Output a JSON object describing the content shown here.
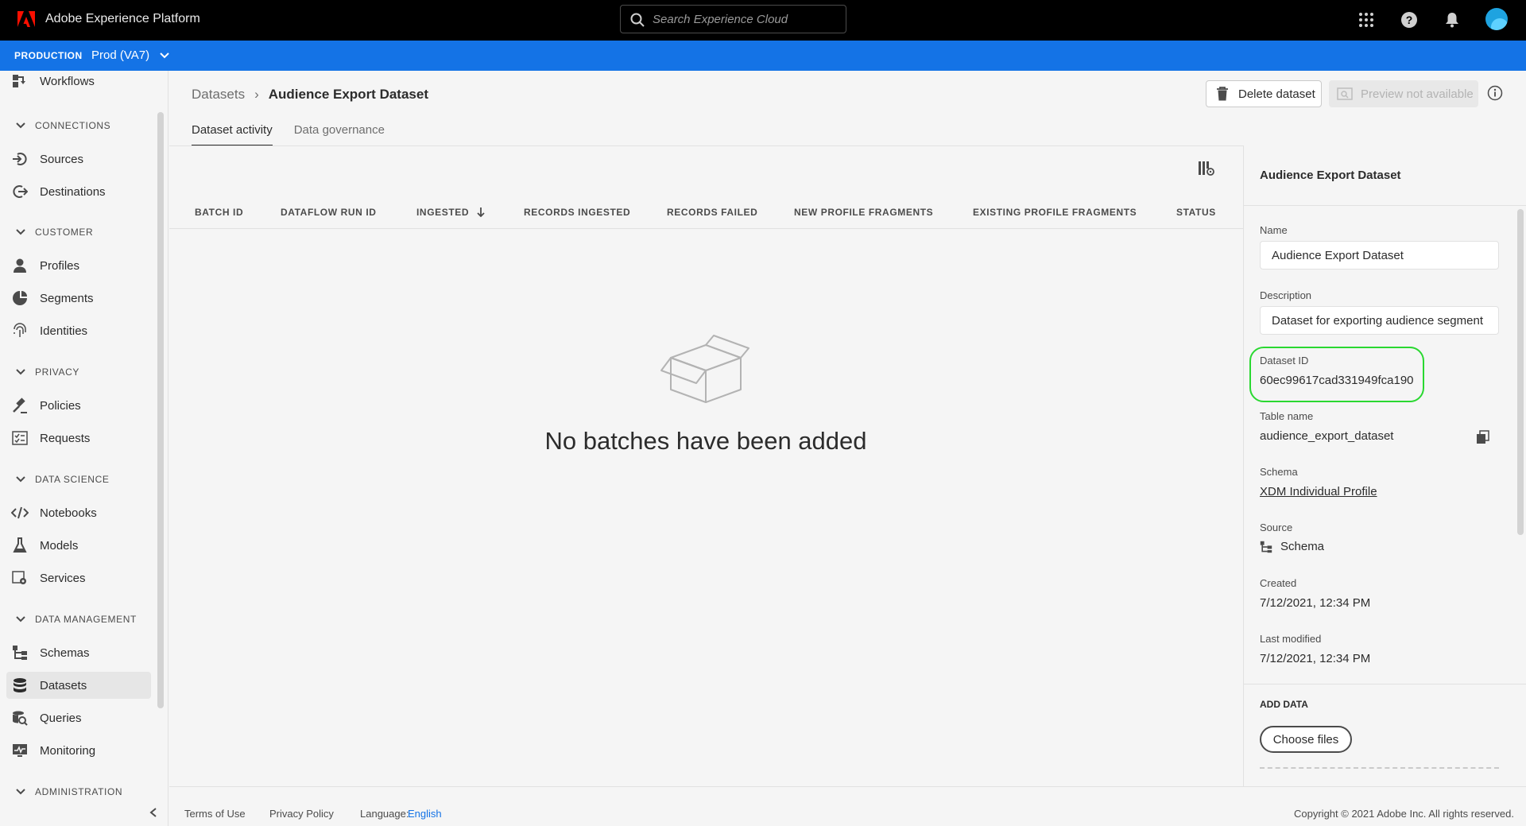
{
  "shell": {
    "app_title": "Adobe Experience Platform",
    "search_placeholder": "Search Experience Cloud"
  },
  "sandbox": {
    "environment": "PRODUCTION",
    "name": "Prod (VA7)"
  },
  "leftnav": {
    "items": [
      {
        "label": "Workflows",
        "icon": "workflows-icon"
      },
      {
        "section": "CONNECTIONS"
      },
      {
        "label": "Sources",
        "icon": "sources-icon"
      },
      {
        "label": "Destinations",
        "icon": "destinations-icon"
      },
      {
        "section": "CUSTOMER"
      },
      {
        "label": "Profiles",
        "icon": "profile-icon"
      },
      {
        "label": "Segments",
        "icon": "segments-icon"
      },
      {
        "label": "Identities",
        "icon": "fingerprint-icon"
      },
      {
        "section": "PRIVACY"
      },
      {
        "label": "Policies",
        "icon": "gavel-icon"
      },
      {
        "label": "Requests",
        "icon": "checklist-icon"
      },
      {
        "section": "DATA SCIENCE"
      },
      {
        "label": "Notebooks",
        "icon": "code-icon"
      },
      {
        "label": "Models",
        "icon": "beaker-icon"
      },
      {
        "label": "Services",
        "icon": "services-icon"
      },
      {
        "section": "DATA MANAGEMENT"
      },
      {
        "label": "Schemas",
        "icon": "schema-icon"
      },
      {
        "label": "Datasets",
        "icon": "database-icon",
        "active": true
      },
      {
        "label": "Queries",
        "icon": "query-icon"
      },
      {
        "label": "Monitoring",
        "icon": "monitoring-icon"
      },
      {
        "section": "ADMINISTRATION"
      }
    ]
  },
  "header": {
    "breadcrumb_parent": "Datasets",
    "breadcrumb_current": "Audience Export Dataset",
    "delete_label": "Delete dataset",
    "preview_label": "Preview not available",
    "tabs": [
      {
        "label": "Dataset activity",
        "active": true
      },
      {
        "label": "Data governance",
        "active": false
      }
    ]
  },
  "table": {
    "columns": [
      "BATCH ID",
      "DATAFLOW RUN ID",
      "INGESTED",
      "RECORDS INGESTED",
      "RECORDS FAILED",
      "NEW PROFILE FRAGMENTS",
      "EXISTING PROFILE FRAGMENTS",
      "STATUS"
    ],
    "sorted_column": "INGESTED",
    "sort_direction": "descending",
    "rows": [],
    "empty_message": "No batches have been added"
  },
  "details": {
    "title": "Audience Export Dataset",
    "name_label": "Name",
    "name_value": "Audience Export Dataset",
    "description_label": "Description",
    "description_value": "Dataset for exporting audience segment",
    "dataset_id_label": "Dataset ID",
    "dataset_id_value": "60ec99617cad331949fca190",
    "table_name_label": "Table name",
    "table_name_value": "audience_export_dataset",
    "schema_label": "Schema",
    "schema_value": "XDM Individual Profile",
    "source_label": "Source",
    "source_value": "Schema",
    "created_label": "Created",
    "created_value": "7/12/2021, 12:34 PM",
    "modified_label": "Last modified",
    "modified_value": "7/12/2021, 12:34 PM",
    "add_data_label": "ADD DATA",
    "choose_files_label": "Choose files",
    "highlight_color": "#2ad831"
  },
  "footer": {
    "terms": "Terms of Use",
    "privacy": "Privacy Policy",
    "language_label": "Language:",
    "language_value": "English",
    "copyright": "Copyright © 2021 Adobe Inc. All rights reserved."
  },
  "colors": {
    "shell": "#000000",
    "sandbox": "#1473e6",
    "avatar": "#1ea3e0",
    "link": "#1473e6"
  }
}
